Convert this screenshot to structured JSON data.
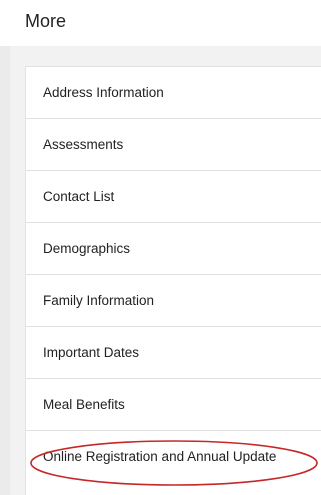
{
  "header": {
    "title": "More"
  },
  "menu": {
    "items": [
      {
        "label": "Address Information"
      },
      {
        "label": "Assessments"
      },
      {
        "label": "Contact List"
      },
      {
        "label": "Demographics"
      },
      {
        "label": "Family Information"
      },
      {
        "label": "Important Dates"
      },
      {
        "label": "Meal Benefits"
      },
      {
        "label": "Online Registration and Annual Update"
      }
    ]
  },
  "colors": {
    "highlight": "#c62828",
    "background": "#f2f2f2",
    "divider": "#e0e0e0"
  }
}
